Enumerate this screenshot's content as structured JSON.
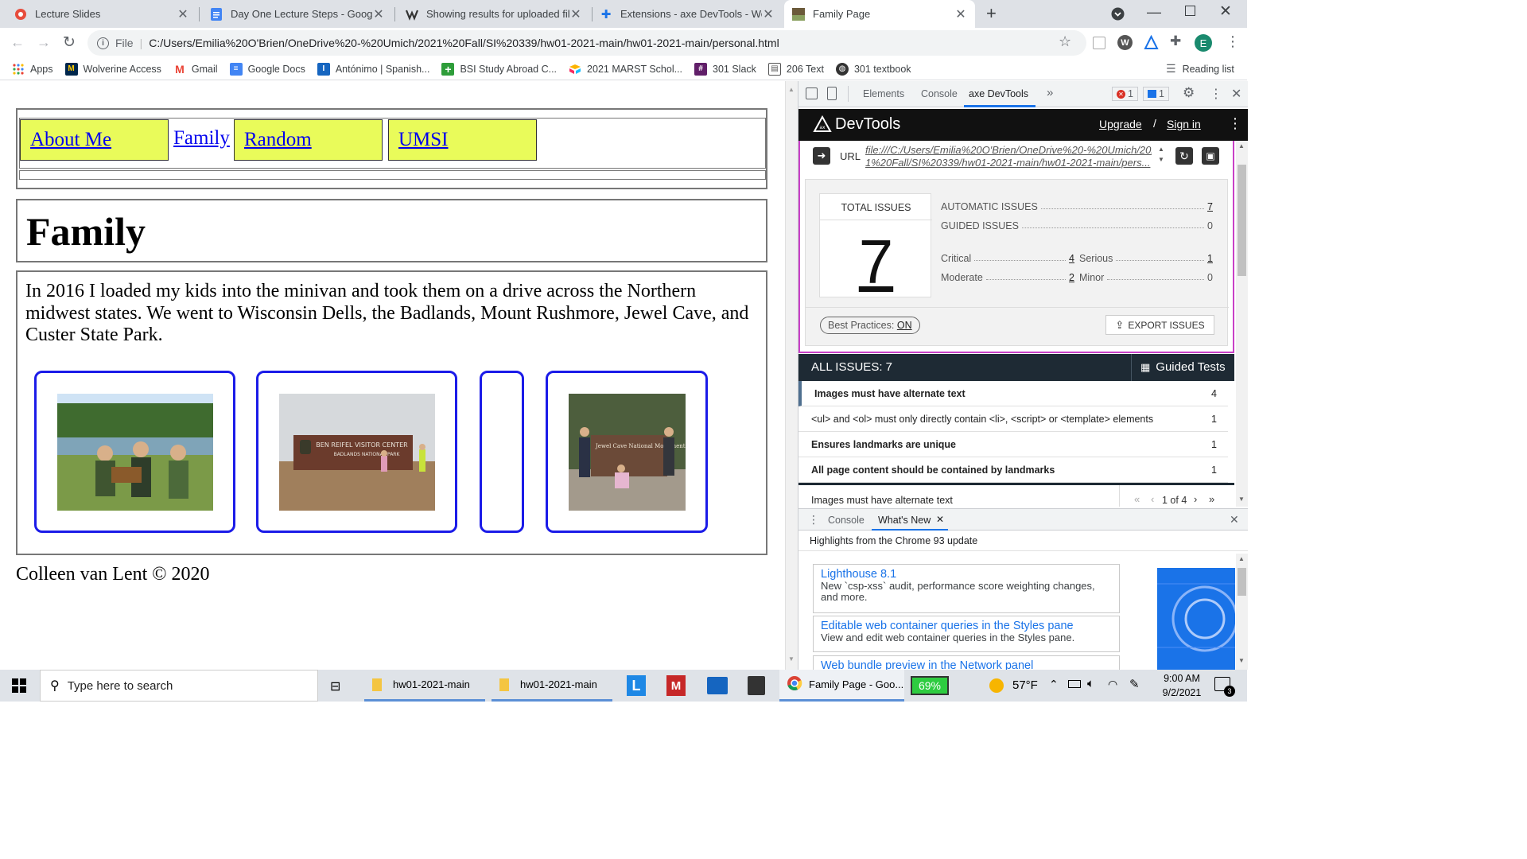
{
  "tabs": [
    {
      "title": "Lecture Slides",
      "active": false
    },
    {
      "title": "Day One Lecture Steps - Google",
      "active": false
    },
    {
      "title": "Showing results for uploaded file",
      "active": false
    },
    {
      "title": "Extensions - axe DevTools - Web",
      "active": false
    },
    {
      "title": "Family Page",
      "active": true
    }
  ],
  "toolbar": {
    "scheme_label": "File",
    "url": "C:/Users/Emilia%20O'Brien/OneDrive%20-%20Umich/2021%20Fall/SI%20339/hw01-2021-main/hw01-2021-main/personal.html",
    "profile_initial": "E"
  },
  "bookmarks": {
    "items": [
      "Apps",
      "Wolverine Access",
      "Gmail",
      "Google Docs",
      "Antónimo | Spanish...",
      "BSI Study Abroad C...",
      "2021 MARST Schol...",
      "301 Slack",
      "206 Text",
      "301 textbook"
    ],
    "reading_list": "Reading list"
  },
  "page": {
    "nav": [
      "About Me",
      "Family",
      "Random",
      "UMSI"
    ],
    "heading": "Family",
    "paragraph": "In 2016 I loaded my kids into the minivan and took them on a drive across the Northern midwest states. We went to Wisconsin Dells, the Badlands, Mount Rushmore, Jewel Cave, and Custer State Park.",
    "photo_sign_1": "BEN REIFEL VISITOR CENTER",
    "photo_sign_2": "BADLANDS NATIONAL PARK",
    "photo_sign_3": "Jewel Cave National Monument",
    "footer": "Colleen van Lent © 2020"
  },
  "devtools": {
    "tabs": [
      "Elements",
      "Console",
      "axe DevTools"
    ],
    "error_count": "1",
    "message_count": "1",
    "axe": {
      "brand": "DevTools",
      "upgrade": "Upgrade",
      "sign_in": "Sign in",
      "url_label": "URL",
      "url_line1": "file:///C:/Users/Emilia%20O'Brien/OneDrive%20-%20Umich/202",
      "url_line2": "1%20Fall/SI%20339/hw01-2021-main/hw01-2021-main/pers...",
      "total_label": "TOTAL ISSUES",
      "total": "7",
      "automatic_label": "AUTOMATIC ISSUES",
      "automatic": "7",
      "guided_label": "GUIDED ISSUES",
      "guided": "0",
      "critical_label": "Critical",
      "critical": "4",
      "serious_label": "Serious",
      "serious": "1",
      "moderate_label": "Moderate",
      "moderate": "2",
      "minor_label": "Minor",
      "minor": "0",
      "best_practices_label": "Best Practices:",
      "best_practices_value": "ON",
      "export": "EXPORT ISSUES",
      "all_issues": "ALL ISSUES: 7",
      "guided_tests": "Guided Tests",
      "issues": [
        {
          "text": "Images must have alternate text",
          "count": "4"
        },
        {
          "text": "<ul> and <ol> must only directly contain <li>, <script> or <template> elements",
          "count": "1"
        },
        {
          "text": "Ensures landmarks are unique",
          "count": "1"
        },
        {
          "text": "All page content should be contained by landmarks",
          "count": "1"
        }
      ],
      "detail_title": "Images must have alternate text",
      "pager": "1 of 4"
    },
    "drawer": {
      "tabs": [
        "Console",
        "What's New"
      ],
      "highlight": "Highlights from the Chrome 93 update",
      "cards": [
        {
          "title": "Lighthouse 8.1",
          "desc": "New `csp-xss` audit, performance score weighting changes, and more."
        },
        {
          "title": "Editable web container queries in the Styles pane",
          "desc": "View and edit web container queries in the Styles pane."
        },
        {
          "title": "Web bundle preview in the Network panel",
          "desc": ""
        }
      ]
    }
  },
  "taskbar": {
    "search_placeholder": "Type here to search",
    "apps": [
      "hw01-2021-main",
      "hw01-2021-main"
    ],
    "chrome_label": "Family Page - Goo...",
    "battery": "69%",
    "weather": "57°F",
    "time": "9:00 AM",
    "date": "9/2/2021",
    "notifications": "3"
  }
}
